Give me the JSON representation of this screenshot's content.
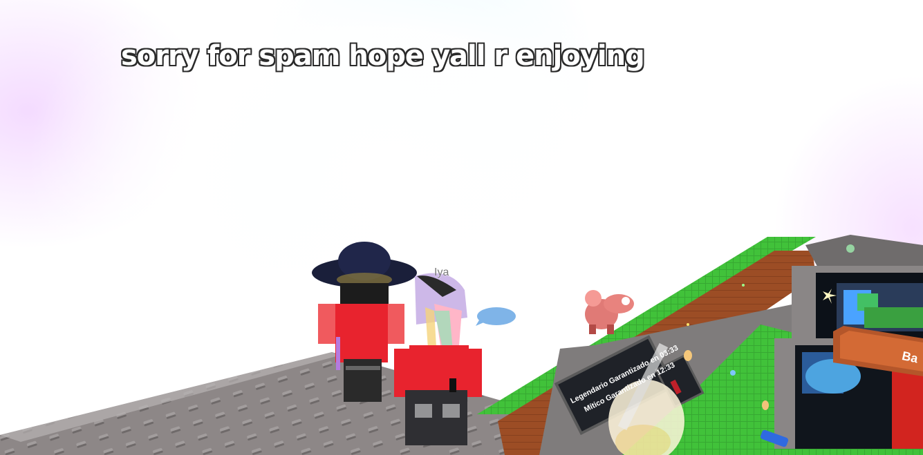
{
  "chat": {
    "message": "sorry for spam hope yall r enjoying"
  },
  "player": {
    "nametag": "Iya"
  },
  "world": {
    "sign_lines": [
      "Legendario Garantizado en 03:33",
      "Mítico Garantizado en 12:33"
    ],
    "building_sign": "Ba"
  },
  "colors": {
    "platform": "#8f8a8a",
    "grass": "#3fbf3a",
    "dirt": "#a0522d",
    "shirt": "#e8232e",
    "sky": "#ffffff"
  }
}
